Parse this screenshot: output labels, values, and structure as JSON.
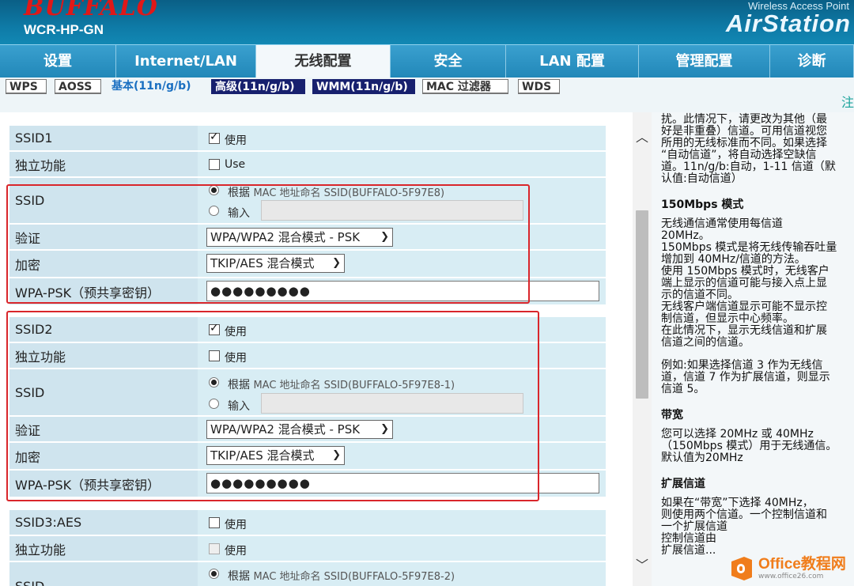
{
  "header": {
    "logo": "BUFFALO",
    "model": "WCR-HP-GN",
    "tagline": "Wireless Access Point",
    "brand": "AirStation"
  },
  "tabs": [
    {
      "label": "设置",
      "active": false
    },
    {
      "label": "Internet/LAN",
      "active": false
    },
    {
      "label": "无线配置",
      "active": true
    },
    {
      "label": "安全",
      "active": false
    },
    {
      "label": "LAN 配置",
      "active": false
    },
    {
      "label": "管理配置",
      "active": false
    },
    {
      "label": "诊断",
      "active": false
    }
  ],
  "subtabs": [
    "WPS",
    "AOSS",
    "基本(11n/g/b)",
    "高级(11n/g/b)",
    "WMM(11n/g/b)",
    "MAC 过滤器",
    "WDS"
  ],
  "subtab_note": "注",
  "form": {
    "ssid1": {
      "label": "SSID1",
      "enable": "使用",
      "standalone_label": "独立功能",
      "standalone_value": "Use",
      "ssid_label": "SSID",
      "radio_mac": "根据",
      "radio_mac_text": "MAC 地址命名 SSID(BUFFALO-5F97E8)",
      "radio_input": "输入",
      "auth_label": "验证",
      "auth_value": "WPA/WPA2 混合模式 - PSK",
      "enc_label": "加密",
      "enc_value": "TKIP/AES 混合模式",
      "psk_label": "WPA-PSK（预共享密钥）",
      "psk_value": "●●●●●●●●●"
    },
    "ssid2": {
      "label": "SSID2",
      "enable": "使用",
      "standalone_label": "独立功能",
      "standalone_value": "使用",
      "ssid_label": "SSID",
      "radio_mac": "根据",
      "radio_mac_text": "MAC 地址命名 SSID(BUFFALO-5F97E8-1)",
      "radio_input": "输入",
      "auth_label": "验证",
      "auth_value": "WPA/WPA2 混合模式 - PSK",
      "enc_label": "加密",
      "enc_value": "TKIP/AES 混合模式",
      "psk_label": "WPA-PSK（预共享密钥）",
      "psk_value": "●●●●●●●●●"
    },
    "ssid3": {
      "label": "SSID3:AES",
      "enable": "使用",
      "standalone_label": "独立功能",
      "standalone_value": "使用",
      "ssid_label": "SSID",
      "radio_mac": "根据",
      "radio_mac_text": "MAC 地址命名 SSID(BUFFALO-5F97E8-2)"
    }
  },
  "help": {
    "intro": [
      "扰。此情况下，请更改为其他（最",
      "好是非重叠）信道。可用信道视您",
      "所用的无线标准而不同。如果选择",
      "“自动信道”，将自动选择空缺信",
      "道。11n/g/b:自动，1-11 信道（默",
      "认值:自动信道）"
    ],
    "h_150": "150Mbps 模式",
    "p_150": [
      "无线通信通常使用每信道",
      "20MHz。",
      "150Mbps 模式是将无线传输吞吐量",
      "增加到 40MHz/信道的方法。",
      "使用 150Mbps 模式时，无线客户",
      "端上显示的信道可能与接入点上显",
      "示的信道不同。",
      "无线客户端信道显示可能不显示控",
      "制信道，但显示中心频率。",
      "在此情况下，显示无线信道和扩展",
      "信道之间的信道。"
    ],
    "p_example": [
      "例如:如果选择信道 3 作为无线信",
      "道，信道 7 作为扩展信道，则显示",
      "信道 5。"
    ],
    "h_bw": "带宽",
    "p_bw": [
      "您可以选择 20MHz 或 40MHz",
      "（150Mbps 模式）用于无线通信。",
      "默认值为20MHz"
    ],
    "h_ext": "扩展信道",
    "p_ext": [
      "如果在“带宽”下选择 40MHz，",
      "则使用两个信道。一个控制信道和",
      "一个扩展信道",
      "控制信道由",
      "扩展信道..."
    ]
  },
  "watermark": {
    "title": "Office教程网",
    "url": "www.office26.com"
  }
}
